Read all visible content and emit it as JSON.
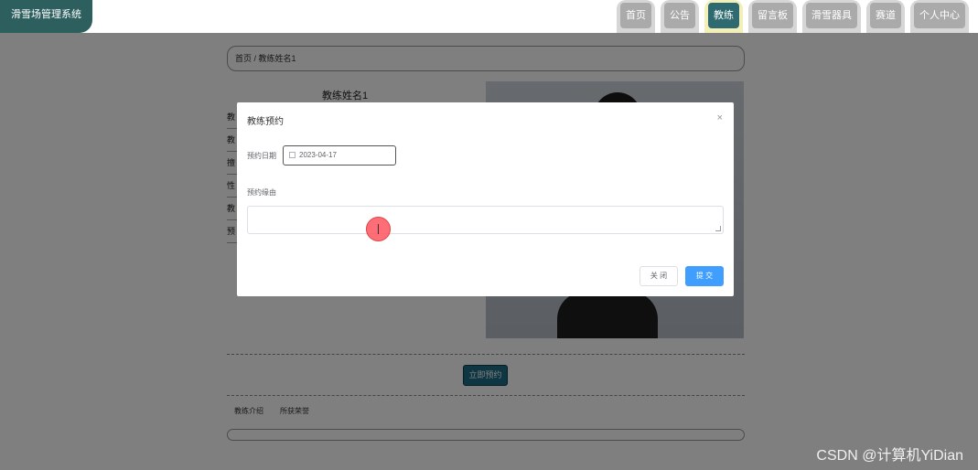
{
  "app": {
    "title": "滑雪场管理系统"
  },
  "nav": {
    "items": [
      {
        "label": "首页",
        "active": false
      },
      {
        "label": "公告",
        "active": false
      },
      {
        "label": "教练",
        "active": true
      },
      {
        "label": "留言板",
        "active": false
      },
      {
        "label": "滑雪器具",
        "active": false
      },
      {
        "label": "赛道",
        "active": false
      },
      {
        "label": "个人中心",
        "active": false
      }
    ]
  },
  "page": {
    "breadcrumb": "首页 / 教练姓名1",
    "coach_name": "教练姓名1",
    "info_rows": [
      "教",
      "教",
      "擅",
      "性",
      "教",
      "预"
    ],
    "book_button": "立即预约",
    "tabs": [
      "教练介绍",
      "所获荣誉"
    ]
  },
  "modal": {
    "title": "教练预约",
    "close_symbol": "×",
    "date_label": "预约日期",
    "date_value": "2023-04-17",
    "reason_label": "预约缘由",
    "reason_value": "",
    "cancel_label": "关 闭",
    "submit_label": "提 交"
  },
  "watermark": "CSDN @计算机YiDian",
  "colors": {
    "brand": "#2e5f5f",
    "nav_active": "#2e6a6f",
    "primary": "#409eff"
  }
}
